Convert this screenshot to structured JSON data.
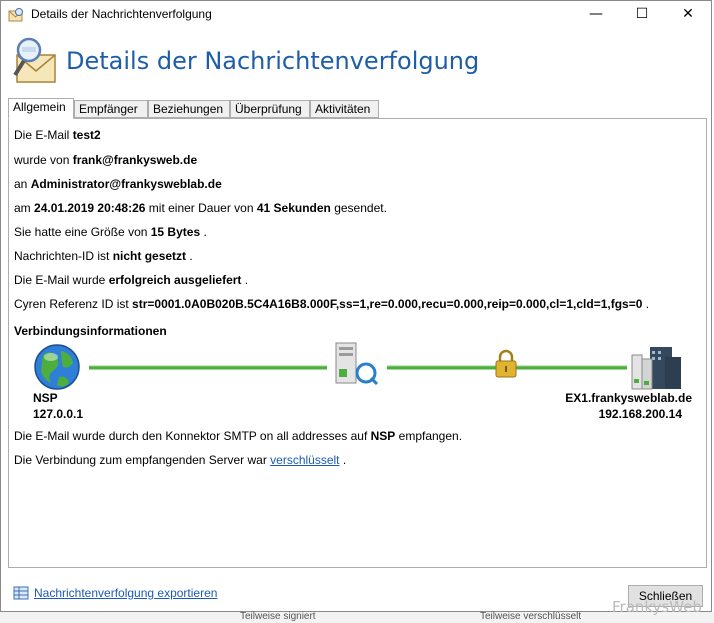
{
  "window": {
    "title": "Details der Nachrichtenverfolgung",
    "minimize_glyph": "—",
    "maximize_glyph": "☐",
    "close_glyph": "✕"
  },
  "header": {
    "title": "Details der Nachrichtenverfolgung"
  },
  "tabs": [
    "Allgemein",
    "Empfänger",
    "Beziehungen",
    "Überprüfung",
    "Aktivitäten"
  ],
  "general": {
    "email_prefix": "Die E-Mail ",
    "subject": "test2",
    "from_prefix": "wurde von ",
    "sender": "frank@frankysweb.de",
    "to_prefix": "an ",
    "recipient": "Administrator@frankysweblab.de",
    "date_prefix": "am ",
    "datetime": "24.01.2019 20:48:26",
    "duration_prefix": " mit einer Dauer von ",
    "duration": "41 Sekunden",
    "duration_suffix": " gesendet.",
    "size_prefix": "Sie hatte eine Größe von ",
    "size": "15 Bytes",
    "size_suffix": " .",
    "msgid_prefix": "Nachrichten-ID ist ",
    "msgid": "nicht gesetzt",
    "msgid_suffix": " .",
    "delivery_prefix": "Die E-Mail wurde ",
    "delivery": "erfolgreich ausgeliefert",
    "delivery_suffix": " .",
    "cyren_prefix": "Cyren Referenz ID ist ",
    "cyren": "str=0001.0A0B020B.5C4A16B8.000F,ss=1,re=0.000,recu=0.000,reip=0.000,cl=1,cld=1,fgs=0",
    "cyren_suffix": "  ."
  },
  "connection": {
    "heading": "Verbindungsinformationen",
    "source_name": "NSP",
    "source_ip": "127.0.0.1",
    "target_name": "EX1.frankysweblab.de",
    "target_ip": "192.168.200.14",
    "received_prefix": "Die E-Mail wurde durch den Konnektor SMTP on all addresses auf ",
    "received_server": "NSP",
    "received_suffix": " empfangen.",
    "encrypted_prefix": "Die Verbindung zum empfangenden Server war  ",
    "encrypted_link": "verschlüsselt",
    "encrypted_suffix": "  ."
  },
  "footer": {
    "export_link": "Nachrichtenverfolgung exportieren",
    "close_button": "Schließen"
  },
  "background_strip": {
    "left_text": "Teilweise signiert",
    "right_text": "Teilweise verschlüsselt"
  },
  "watermark": "FrankysWeb",
  "colors": {
    "accent": "#1e5ea8",
    "link": "#1c5ab3",
    "line_green": "#4caf3d"
  }
}
